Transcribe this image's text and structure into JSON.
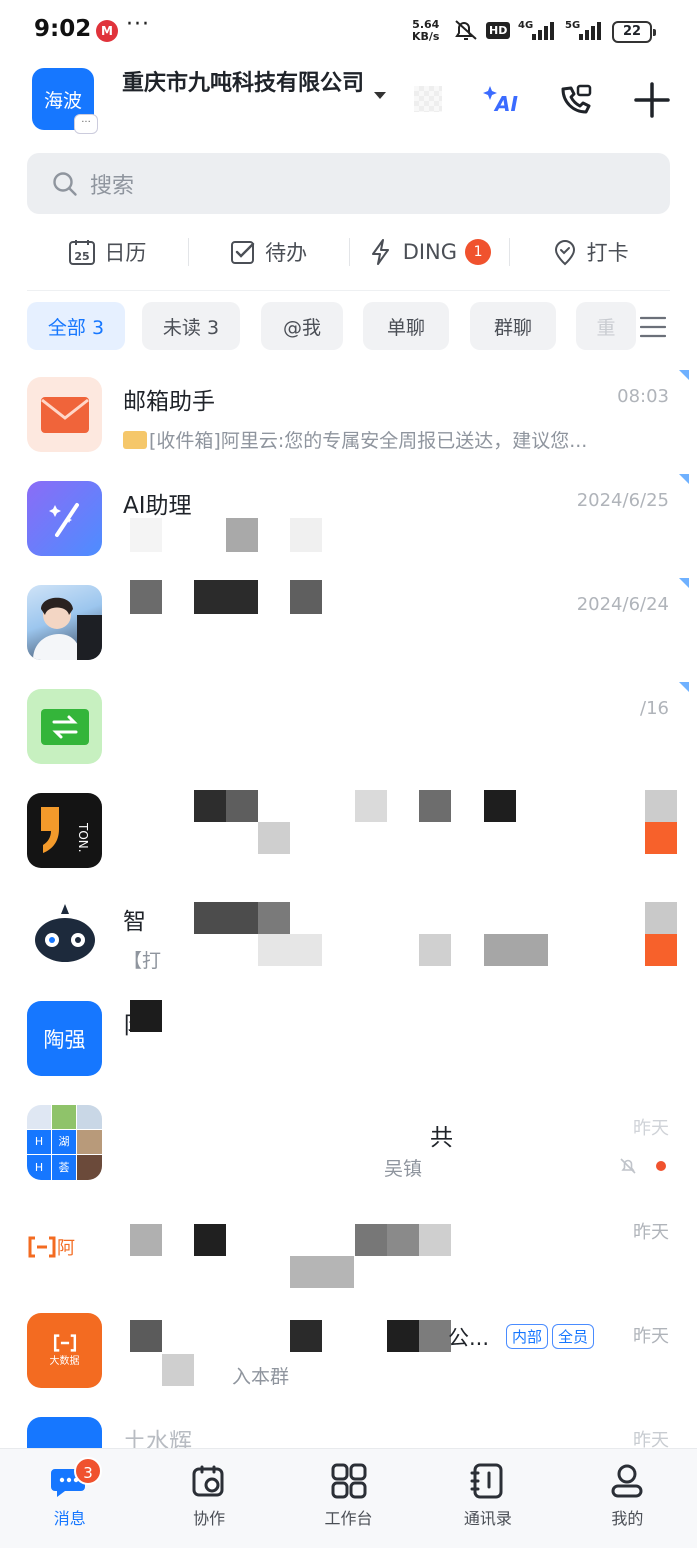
{
  "status_bar": {
    "time": "9:02",
    "dots": "···",
    "net_speed_value": "5.64",
    "net_speed_unit": "KB/s",
    "hd": "HD",
    "sim1": "4G",
    "sim2": "5G",
    "battery": "22"
  },
  "header": {
    "avatar_text": "海波",
    "org_name": "重庆市九吨科技有限公司",
    "ai_label": "AI"
  },
  "search": {
    "placeholder": "搜索"
  },
  "quick_actions": [
    {
      "label": "日历",
      "icon": "calendar-icon",
      "icon_text": "25"
    },
    {
      "label": "待办",
      "icon": "todo-check-icon"
    },
    {
      "label": "DING",
      "icon": "lightning-icon",
      "badge": "1"
    },
    {
      "label": "打卡",
      "icon": "location-check-icon"
    }
  ],
  "filters": [
    {
      "label": "全部 3",
      "active": true
    },
    {
      "label": "未读 3"
    },
    {
      "label": "@我"
    },
    {
      "label": "单聊"
    },
    {
      "label": "群聊"
    },
    {
      "label": "重"
    }
  ],
  "chats": [
    {
      "title": "邮箱助手",
      "preview": "[收件箱]阿里云:您的专属安全周报已送达，建议您...",
      "time": "08:03"
    },
    {
      "title": "AI助理",
      "preview": "",
      "time": "2024/6/25"
    },
    {
      "title": "",
      "preview": "",
      "time": "2024/6/24"
    },
    {
      "title": "",
      "preview": "",
      "time": "/16"
    },
    {
      "title": "",
      "preview": "",
      "time": ""
    },
    {
      "title": "智",
      "preview": "【打",
      "time": ""
    },
    {
      "title": "阝",
      "preview": "",
      "time": "",
      "avatar_text": "陶强"
    },
    {
      "title": "共",
      "preview": "吴镇",
      "time": "昨天",
      "avatar_cells": [
        "H",
        "湖",
        "H",
        "荟"
      ]
    },
    {
      "title": "",
      "preview": "",
      "time": "昨天",
      "avatar_text": "阿"
    },
    {
      "title": "公...",
      "preview": "入本群",
      "time": "昨天",
      "tags": [
        "内部",
        "全员"
      ],
      "avatar_text": "大数据"
    },
    {
      "title": "土水辉",
      "preview": "",
      "time": "昨天"
    }
  ],
  "tabs": [
    {
      "label": "消息",
      "icon": "message-icon",
      "badge": "3",
      "active": true
    },
    {
      "label": "协作",
      "icon": "collaborate-icon"
    },
    {
      "label": "工作台",
      "icon": "workbench-grid-icon"
    },
    {
      "label": "通讯录",
      "icon": "contacts-book-icon"
    },
    {
      "label": "我的",
      "icon": "profile-icon"
    }
  ],
  "colors": {
    "accent": "#1677ff",
    "badge": "#f0522e",
    "mail": "#f0643a"
  }
}
